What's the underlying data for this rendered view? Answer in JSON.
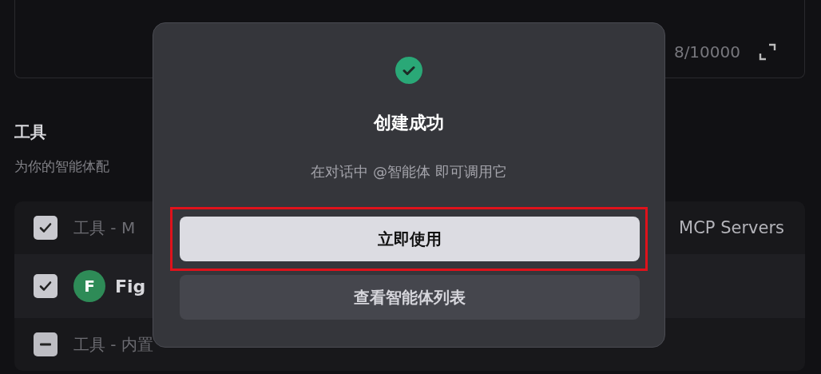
{
  "editor": {
    "counter": "8/10000"
  },
  "tools_section": {
    "title": "工具",
    "description": "为你的智能体配"
  },
  "tool_rows": [
    {
      "kind": "group",
      "label": "工具 - M",
      "trailing": "MCP Servers",
      "checked": true,
      "indeterminate": false,
      "highlighted": false
    },
    {
      "kind": "server",
      "avatar": "F",
      "color": "#2e8b57",
      "label": "Fig",
      "checked": true,
      "indeterminate": false,
      "highlighted": true
    },
    {
      "kind": "group",
      "label": "工具 - 内置",
      "checked": false,
      "indeterminate": true,
      "highlighted": false
    }
  ],
  "dialog": {
    "title": "创建成功",
    "message": "在对话中 @智能体 即可调用它",
    "buttons": [
      {
        "label": "立即使用",
        "kind": "primary",
        "outlined": true
      },
      {
        "label": "查看智能体列表",
        "kind": "secondary",
        "outlined": false
      }
    ]
  }
}
